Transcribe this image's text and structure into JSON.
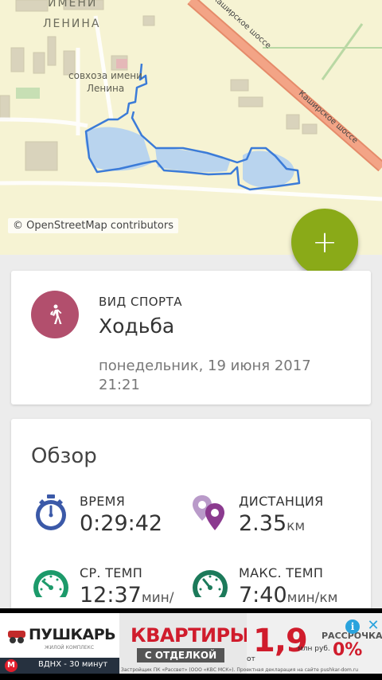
{
  "map": {
    "labels": {
      "top": "ИМЕНИ",
      "lenin": "ЛЕНИНА",
      "sovkhoz_line1": "совхоза имени",
      "sovkhoz_line2": "Ленина",
      "road1": "Каширское шоссе",
      "road2": "Каширское шоссе"
    },
    "attribution": "© OpenStreetMap contributors",
    "route_color": "#3b7bd8",
    "water_color": "#b9d4ee"
  },
  "fab": {
    "label": "+",
    "color": "#8aaa18"
  },
  "activity": {
    "sport_label": "ВИД СПОРТА",
    "sport_value": "Ходьба",
    "date_line1": "понедельник, 19 июня 2017",
    "date_line2": "21:21",
    "avatar_color": "#b24f6d",
    "avatar_icon": "walking-person-icon"
  },
  "overview": {
    "title": "Обзор",
    "time": {
      "label": "ВРЕМЯ",
      "value": "0:29:42",
      "icon": "stopwatch-icon"
    },
    "distance": {
      "label": "ДИСТАНЦИЯ",
      "value": "2.35",
      "unit": "км",
      "icon": "map-pin-icon"
    },
    "avg_pace": {
      "label": "СР. ТЕМП",
      "value": "12:37",
      "unit": "мин/",
      "icon": "speedometer-icon"
    },
    "max_pace": {
      "label": "МАКС. ТЕМП",
      "value": "7:40",
      "unit": "мин/км",
      "icon": "speedometer-icon"
    }
  },
  "ad": {
    "brand": "ПУШКАРЬ",
    "brand_sub": "ЖИЛОЙ КОМПЛЕКС",
    "metro": "ВДНХ - 30 минут",
    "headline": "КВАРТИРЫ",
    "sub": "С ОТДЕЛКОЙ",
    "from": "от",
    "price": "1,9",
    "price_unit": "млн руб.",
    "installment": "РАССРОЧКА",
    "percent": "0%",
    "fine_print": "Застройщик ПК «Рассвет» (ООО «КВС МСК»). Проектная декларация на сайте pushkar-dom.ru",
    "info_icon": "info-icon",
    "close_icon": "close-icon"
  }
}
